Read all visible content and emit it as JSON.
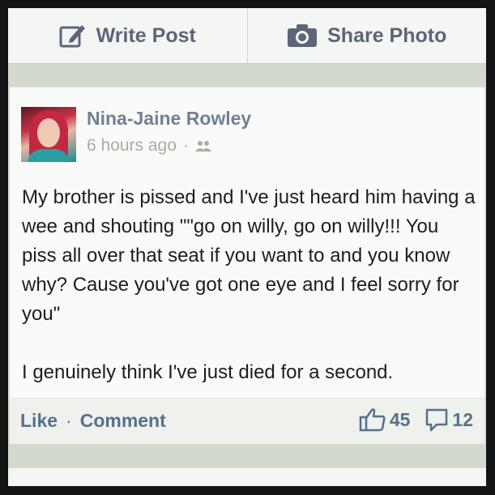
{
  "toolbar": {
    "write_label": "Write Post",
    "share_label": "Share Photo"
  },
  "post": {
    "author": "Nina-Jaine Rowley",
    "time": "6 hours ago",
    "separator": "·",
    "audience_icon": "friends-icon",
    "paragraphs": [
      "My brother is pissed and I've just heard him having a wee and shouting \"\"go on willy, go on willy!!! You piss all over that seat if you want to and you know why? Cause you've got one eye and I feel sorry for you\"",
      "I genuinely think I've just died for a second."
    ]
  },
  "actions": {
    "like_label": "Like",
    "separator": "·",
    "comment_label": "Comment",
    "like_count": "45",
    "comment_count": "12"
  },
  "colors": {
    "link": "#56708d",
    "name": "#6f8196",
    "meta": "#a6aea2"
  }
}
